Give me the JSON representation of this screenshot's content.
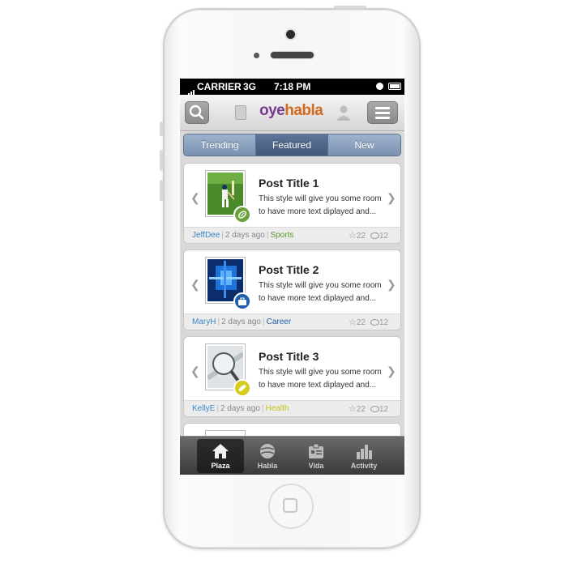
{
  "status_bar": {
    "carrier": "CARRIER",
    "network": "3G",
    "time": "7:18 PM"
  },
  "nav": {
    "logo_part1": "oye",
    "logo_part2": "habla",
    "search_icon": "search-icon",
    "menu_icon": "hamburger-icon",
    "document_icon": "document-icon",
    "user_icon": "user-icon"
  },
  "tabs": [
    {
      "label": "Trending",
      "active": false
    },
    {
      "label": "Featured",
      "active": true
    },
    {
      "label": "New",
      "active": false
    }
  ],
  "posts": [
    {
      "title": "Post Title 1",
      "text": "This style will give you some room to have more text diplayed and...",
      "user": "JeffDee",
      "time": "2 days ago",
      "category": "Sports",
      "category_color": "#5a9a2e",
      "badge_color": "#6aa33b",
      "badge_icon": "football-icon",
      "likes": "22",
      "comments": "12"
    },
    {
      "title": "Post Title 2",
      "text": "This style will give you some room to have more text diplayed and...",
      "user": "MaryH",
      "time": "2 days ago",
      "category": "Career",
      "category_color": "#1f5fa8",
      "badge_color": "#1f5fa8",
      "badge_icon": "briefcase-icon",
      "likes": "22",
      "comments": "12"
    },
    {
      "title": "Post Title 3",
      "text": "This style will give you some room to have more text diplayed and...",
      "user": "KellyE",
      "time": "2 days ago",
      "category": "Health",
      "category_color": "#c9c21e",
      "badge_color": "#d4cd1f",
      "badge_icon": "pill-icon",
      "likes": "22",
      "comments": "12"
    }
  ],
  "tabbar": [
    {
      "label": "Plaza",
      "icon": "house-icon",
      "active": true
    },
    {
      "label": "Habla",
      "icon": "globe-icon",
      "active": false
    },
    {
      "label": "Vida",
      "icon": "id-card-icon",
      "active": false
    },
    {
      "label": "Activity",
      "icon": "bar-chart-icon",
      "active": false
    }
  ]
}
